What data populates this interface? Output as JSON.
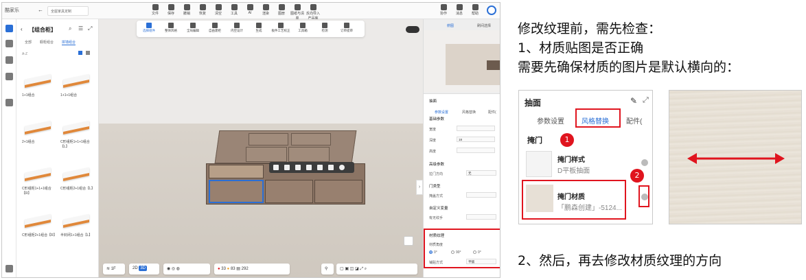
{
  "app": {
    "brand": "酷家乐",
    "project_name": "全屋家具定制",
    "toolbar": [
      {
        "label": "文件",
        "icon": "file-icon"
      },
      {
        "label": "保存",
        "icon": "save-icon"
      },
      {
        "label": "撤销",
        "icon": "undo-icon"
      },
      {
        "label": "恢复",
        "icon": "redo-icon"
      },
      {
        "label": "清空",
        "icon": "clear-icon"
      },
      {
        "label": "工具",
        "icon": "tool-icon"
      },
      {
        "label": "AI",
        "icon": "ai-icon"
      },
      {
        "label": "渲染",
        "icon": "render-icon"
      },
      {
        "label": "图册",
        "icon": "album-icon"
      },
      {
        "label": "图纸与清单",
        "icon": "drawing-icon"
      },
      {
        "label": "反向导入产品库",
        "icon": "import-icon"
      }
    ],
    "toolbar_right": [
      {
        "label": "协作",
        "icon": "collab-icon"
      },
      {
        "label": "消息",
        "icon": "message-icon"
      },
      {
        "label": "帮助",
        "icon": "help-icon"
      }
    ]
  },
  "left_panel": {
    "title": "【组合柜】",
    "tabs": [
      "全部",
      "橱柜组合",
      "拼墙组合"
    ],
    "active_tab": "拼墙组合",
    "filter": "A-Z",
    "items": [
      "1+1组合",
      "1+1+1组合",
      "2+1组合",
      "C形组柜1+1+1组合【L】",
      "C形组柜1+1+1组合【R】",
      "C形组柜2+1组合【L】",
      "C形组柜2+1组合【R】",
      "半封闭1+1组合【L】"
    ]
  },
  "view_toolbar": [
    {
      "label": "选择组件",
      "active": true
    },
    {
      "label": "整体风格"
    },
    {
      "label": "全局编辑"
    },
    {
      "label": "自由建柜"
    },
    {
      "label": "内空设计"
    },
    {
      "label": "生成"
    },
    {
      "label": "板件工艺校正"
    },
    {
      "label": "工具箱"
    },
    {
      "label": "检测"
    },
    {
      "label": "订单提审"
    }
  ],
  "bottom_bar": {
    "floor": "1F",
    "view2d": "2D",
    "view3d": "3D",
    "error_count": "33",
    "warning_count": "83",
    "board_count": "292"
  },
  "right_panel": {
    "tabs": [
      "俯图",
      "刷间选择"
    ],
    "title": "抽面",
    "sub_tabs": [
      "参数设置",
      "风格替换",
      "配件("
    ],
    "sections": {
      "basic": "基础参数",
      "width_label": "宽度",
      "depth_label": "深度",
      "height_label": "高度",
      "depth_value": "18",
      "advanced": "高级参数",
      "handle_dir_label": "拉门方向",
      "handle_dir_value": "无",
      "door_type": "门类型",
      "door_style_label": "掩盖方式",
      "custom_var": "自定义变量",
      "texture_label": "有无纹手",
      "material_texture": "材质纹理",
      "angle_label": "材质角度",
      "angle_options": [
        "0°",
        "90°",
        "0°"
      ],
      "tile_label": "铺贴方式",
      "tile_value": "平铺"
    }
  },
  "annotation": {
    "line1": "修改纹理前，需先检查：",
    "line2": "1、材质贴图是否正确",
    "line3": "需要先确保材质的图片是默认横向的：",
    "line4": "2、然后，再去修改材质纹理的方向"
  },
  "callout": {
    "title": "抽面",
    "tab1": "参数设置",
    "tab2": "风格替换",
    "tab3": "配件(",
    "section": "掩门",
    "style_label": "掩门样式",
    "style_value": "D平板抽面",
    "material_label": "掩门材质",
    "material_value": "「鹏森创建」-5124...",
    "badge1": "1",
    "badge2": "2"
  },
  "colors": {
    "accent": "#2a6fd6",
    "highlight": "#e0141e",
    "wood": "#8f7a6a"
  }
}
